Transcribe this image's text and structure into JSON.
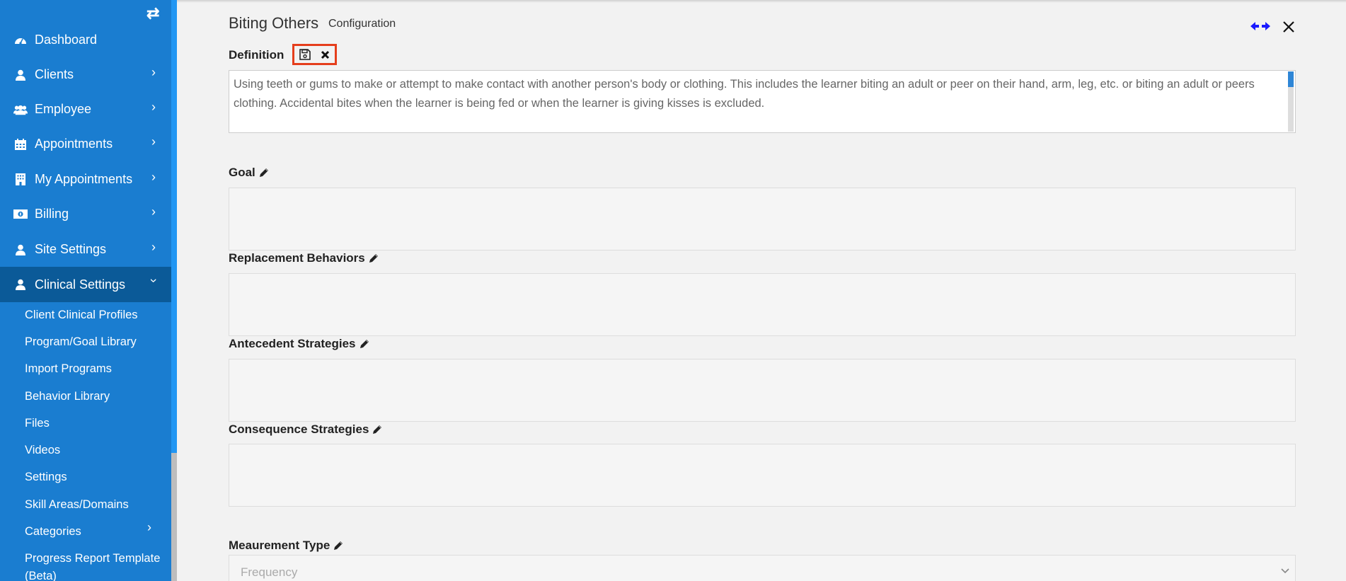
{
  "sidebar": {
    "items": [
      {
        "label": "Dashboard",
        "icon": "dashboard-icon",
        "has_chevron": false
      },
      {
        "label": "Clients",
        "icon": "user-icon",
        "has_chevron": true
      },
      {
        "label": "Employee",
        "icon": "users-icon",
        "has_chevron": true
      },
      {
        "label": "Appointments",
        "icon": "calendar-icon",
        "has_chevron": true
      },
      {
        "label": "My Appointments",
        "icon": "building-icon",
        "has_chevron": true
      },
      {
        "label": "Billing",
        "icon": "money-icon",
        "has_chevron": true
      },
      {
        "label": "Site Settings",
        "icon": "user-icon",
        "has_chevron": true
      },
      {
        "label": "Clinical Settings",
        "icon": "user-icon",
        "has_chevron": true,
        "active": true
      }
    ],
    "sub_items": [
      "Client Clinical Profiles",
      "Program/Goal Library",
      "Import Programs",
      "Behavior Library",
      "Files",
      "Videos",
      "Settings",
      "Skill Areas/Domains",
      "Categories",
      "Progress Report Template",
      "(Beta)"
    ]
  },
  "header": {
    "title": "Biting Others",
    "subtitle": "Configuration"
  },
  "fields": {
    "definition_label": "Definition",
    "definition_text": "Using teeth or gums to make or attempt to make contact with another person's body or clothing. This includes the learner biting an adult or peer on their hand, arm, leg, etc. or biting an adult or peers clothing. Accidental bites when the learner is being fed or when the learner is giving kisses is excluded.",
    "goal_label": "Goal",
    "goal_value": "",
    "replacement_label": "Replacement Behaviors",
    "replacement_value": "",
    "antecedent_label": "Antecedent Strategies",
    "antecedent_value": "",
    "consequence_label": "Consequence Strategies",
    "consequence_value": "",
    "measurement_label": "Meaurement Type",
    "measurement_value": "Frequency"
  },
  "colors": {
    "sidebar_bg": "#1a7dd0",
    "sidebar_active": "#0b5a98",
    "highlight_border": "#e53e1c",
    "expand_icon": "#1a1aff"
  }
}
